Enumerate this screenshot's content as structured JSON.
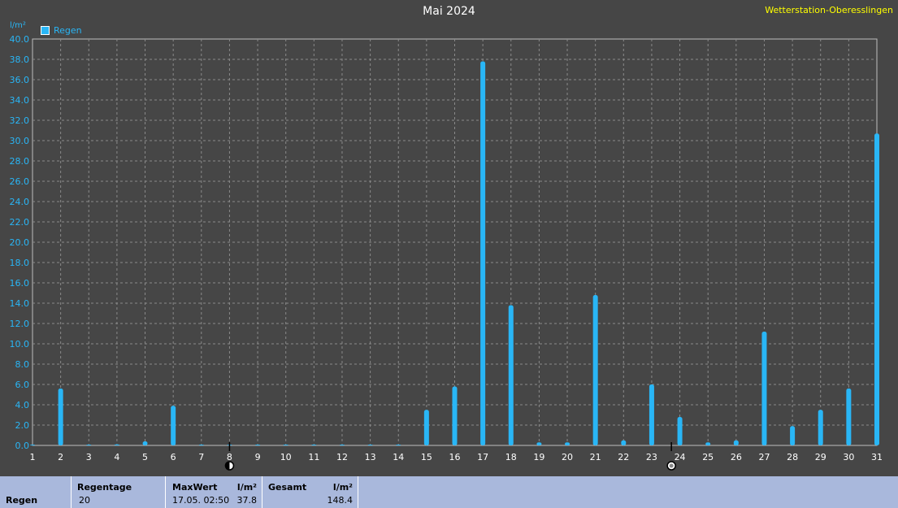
{
  "chart_data": {
    "type": "bar",
    "title": "Mai 2024",
    "station": "Wetterstation-Oberesslingen",
    "ylabel": "l/m²",
    "ylim": [
      0,
      40
    ],
    "yticks": [
      "0.0",
      "2.0",
      "4.0",
      "6.0",
      "8.0",
      "10.0",
      "12.0",
      "14.0",
      "16.0",
      "18.0",
      "20.0",
      "22.0",
      "24.0",
      "26.0",
      "28.0",
      "30.0",
      "32.0",
      "34.0",
      "36.0",
      "38.0",
      "40.0"
    ],
    "categories": [
      "1",
      "2",
      "3",
      "4",
      "5",
      "6",
      "7",
      "8",
      "9",
      "10",
      "11",
      "12",
      "13",
      "14",
      "15",
      "16",
      "17",
      "18",
      "19",
      "20",
      "21",
      "22",
      "23",
      "24",
      "25",
      "26",
      "27",
      "28",
      "29",
      "30",
      "31"
    ],
    "series": [
      {
        "name": "Regen",
        "color": "#29b6f6",
        "values": [
          0.0,
          5.6,
          0.0,
          0.1,
          0.4,
          3.9,
          0.0,
          0.0,
          0.0,
          0.0,
          0.0,
          0.0,
          0.0,
          0.0,
          3.5,
          5.8,
          37.8,
          13.8,
          0.3,
          0.3,
          14.8,
          0.5,
          6.0,
          2.8,
          0.3,
          0.5,
          11.2,
          1.9,
          3.5,
          5.6,
          30.7
        ]
      }
    ],
    "moon_phases": [
      {
        "day": 8,
        "icon": "new-moon-icon"
      },
      {
        "day": 23.7,
        "icon": "full-moon-icon"
      }
    ],
    "grid": true,
    "legend_position": "top-left"
  },
  "summary": {
    "row_label": "Regen",
    "regentage_label": "Regentage",
    "regentage_value": "20",
    "maxwert_label": "MaxWert",
    "maxwert_unit": "l/m²",
    "maxwert_date": "17.05.  02:50",
    "maxwert_value": "37.8",
    "gesamt_label": "Gesamt",
    "gesamt_unit": "l/m²",
    "gesamt_value": "148.4"
  }
}
